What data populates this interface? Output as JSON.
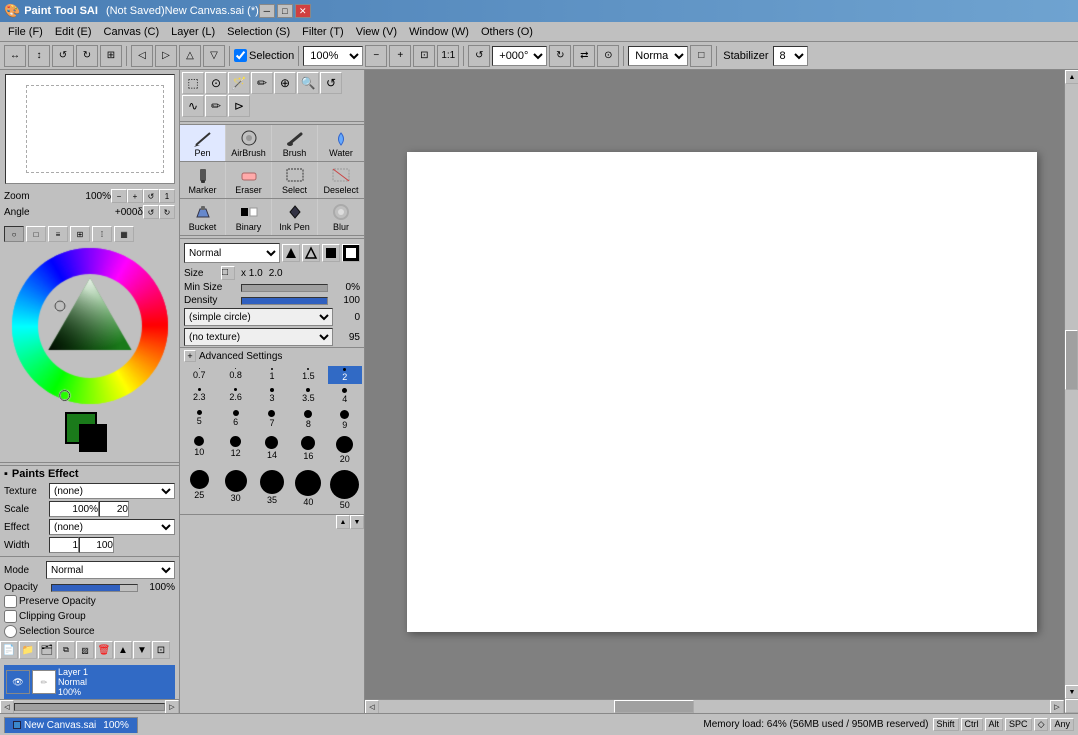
{
  "app": {
    "title": "(Not Saved)New Canvas.sai (*)",
    "icon": "🎨"
  },
  "titlebar": {
    "minimize": "─",
    "maximize": "□",
    "close": "✕"
  },
  "menu": {
    "items": [
      {
        "label": "File (F)",
        "id": "file"
      },
      {
        "label": "Edit (E)",
        "id": "edit"
      },
      {
        "label": "Canvas (C)",
        "id": "canvas"
      },
      {
        "label": "Layer (L)",
        "id": "layer"
      },
      {
        "label": "Selection (S)",
        "id": "selection"
      },
      {
        "label": "Filter (T)",
        "id": "filter"
      },
      {
        "label": "View (V)",
        "id": "view"
      },
      {
        "label": "Window (W)",
        "id": "window"
      },
      {
        "label": "Others (O)",
        "id": "others"
      }
    ]
  },
  "toolbar": {
    "zoom": "100%",
    "rotation": "+000°",
    "selection_checked": true,
    "selection_label": "Selection",
    "mode": "Normal",
    "stabilizer_label": "Stabilizer",
    "stabilizer_value": "8"
  },
  "color_panel": {
    "mode_buttons": [
      "circle",
      "square",
      "lines",
      "grid",
      "dots",
      "color"
    ]
  },
  "paints_effect": {
    "title": "Paints Effect",
    "texture_label": "Texture",
    "texture_value": "(none)",
    "scale_label": "Scale",
    "scale_value": "100%",
    "scale_right": "20",
    "effect_label": "Effect",
    "effect_value": "(none)",
    "width_label": "Width",
    "width_value": "1",
    "width_max": "100"
  },
  "layer_props": {
    "mode_label": "Mode",
    "mode_value": "Normal",
    "opacity_label": "Opacity",
    "opacity_value": "100%",
    "preserve_opacity": "Preserve Opacity",
    "clipping_group": "Clipping Group",
    "selection_source": "Selection Source"
  },
  "tools": {
    "selection_tools": [
      "⬚",
      "⊙",
      "⟳",
      "✎",
      "⊕",
      "🔍",
      "↺",
      "∿",
      "✏",
      "⊳"
    ],
    "brush_types": [
      {
        "name": "Pen",
        "icon": "✒"
      },
      {
        "name": "AirBrush",
        "icon": "💨"
      },
      {
        "name": "Brush",
        "icon": "🖌"
      },
      {
        "name": "Water",
        "icon": "💧"
      },
      {
        "name": "Marker",
        "icon": "🖊"
      },
      {
        "name": "Eraser",
        "icon": "◻"
      },
      {
        "name": "Select",
        "icon": "⬚"
      },
      {
        "name": "Deselect",
        "icon": "⊗"
      },
      {
        "name": "Bucket",
        "icon": "🪣"
      },
      {
        "name": "Binary",
        "icon": "▪"
      },
      {
        "name": "Ink Pen",
        "icon": "✒"
      },
      {
        "name": "Blur",
        "icon": "◌"
      }
    ],
    "active_brush": "Pen"
  },
  "brush_settings": {
    "mode": "Normal",
    "size_label": "Size",
    "size_multiplier": "x 1.0",
    "size_value": "2.0",
    "min_size_label": "Min Size",
    "min_size_value": "0%",
    "density_label": "Density",
    "density_value": "100",
    "brush_shape": "(simple circle)",
    "brush_shape_value": "0",
    "texture": "(no texture)",
    "texture_value": "95",
    "advanced_settings": "Advanced Settings"
  },
  "brush_sizes": [
    {
      "size": 0.7,
      "dot": 1
    },
    {
      "size": 0.8,
      "dot": 1
    },
    {
      "size": 1,
      "dot": 2
    },
    {
      "size": 1.5,
      "dot": 2
    },
    {
      "size": 2,
      "dot": 3,
      "selected": true
    },
    {
      "size": 2.3,
      "dot": 3
    },
    {
      "size": 2.6,
      "dot": 3
    },
    {
      "size": 3,
      "dot": 4
    },
    {
      "size": 3.5,
      "dot": 4
    },
    {
      "size": 4,
      "dot": 5
    },
    {
      "size": 5,
      "dot": 5
    },
    {
      "size": 6,
      "dot": 6
    },
    {
      "size": 7,
      "dot": 7
    },
    {
      "size": 8,
      "dot": 8
    },
    {
      "size": 9,
      "dot": 9
    },
    {
      "size": 10,
      "dot": 10
    },
    {
      "size": 12,
      "dot": 11
    },
    {
      "size": 14,
      "dot": 13
    },
    {
      "size": 16,
      "dot": 15
    },
    {
      "size": 20,
      "dot": 18
    },
    {
      "size": 25,
      "dot": 20
    },
    {
      "size": 30,
      "dot": 23
    },
    {
      "size": 35,
      "dot": 25
    },
    {
      "size": 40,
      "dot": 27
    },
    {
      "size": 50,
      "dot": 30
    }
  ],
  "layers": {
    "toolbar_buttons": [
      "new",
      "folder",
      "group",
      "duplicate",
      "eye-off",
      "mask",
      "merge-down",
      "delete",
      "move-up",
      "move-down"
    ],
    "items": [
      {
        "name": "Layer 1",
        "mode": "Normal",
        "opacity": "100%",
        "visible": true,
        "active": true
      }
    ]
  },
  "status_bar": {
    "tab_label": "New Canvas.sai",
    "tab_zoom": "100%",
    "memory_label": "Memory load: 64% (56MB used / 950MB reserved)",
    "keys": [
      "Shift",
      "Ctrl",
      "Alt",
      "SPC",
      "◇",
      "Any"
    ]
  }
}
